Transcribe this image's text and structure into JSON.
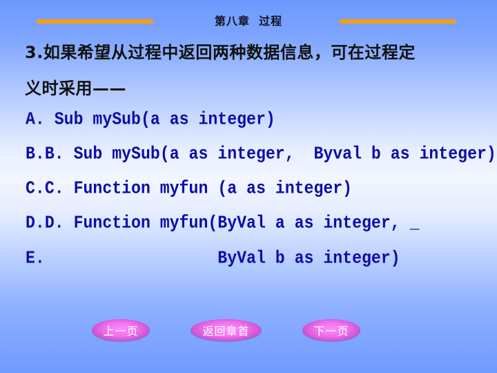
{
  "header": {
    "chapter_title": "第八章  过程",
    "accent_color": "#ff9e0d"
  },
  "question": {
    "line1": "3.如果希望从过程中返回两种数据信息，可在过程定",
    "line2": "义时采用——"
  },
  "options": [
    {
      "id": "A",
      "text": "A. Sub mySub(a as integer)"
    },
    {
      "id": "B",
      "text": "B.B. Sub mySub(a as integer,  Byval b as integer)"
    },
    {
      "id": "C",
      "text": "C.C. Function myfun (a as integer)"
    },
    {
      "id": "D",
      "text": "D.D. Function myfun(ByVal a as integer, _"
    },
    {
      "id": "E",
      "text": "E.                  ByVal b as integer)"
    }
  ],
  "navigation": {
    "prev_label": "上一页",
    "home_label": "返回章首",
    "next_label": "下一页"
  },
  "colors": {
    "option_text": "#0d0da8",
    "button_fill": "#f070ee",
    "background_top": "#6d99ff",
    "background_mid": "#f2f6ff"
  }
}
